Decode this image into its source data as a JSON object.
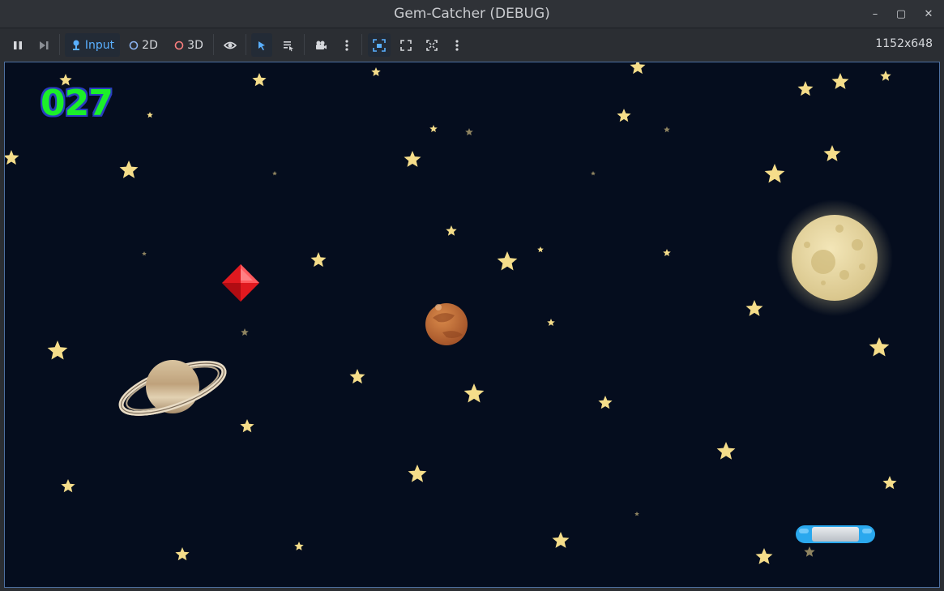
{
  "window": {
    "title": "Gem-Catcher (DEBUG)",
    "controls": [
      "–",
      "▢",
      "✕"
    ]
  },
  "toolbar": {
    "pause_icon": "pause-icon",
    "step_icon": "step-frame-icon",
    "input_label": "Input",
    "mode_2d_label": "2D",
    "mode_3d_label": "3D",
    "resolution": "1152x648"
  },
  "game": {
    "score": "027",
    "colors": {
      "background": "#050d1e",
      "star": "#f5dd8a",
      "gem": "#e0191f",
      "score_fill": "#1cef2a",
      "score_outline": "#2a3fbe",
      "paddle_blue": "#2aa8ee"
    }
  }
}
